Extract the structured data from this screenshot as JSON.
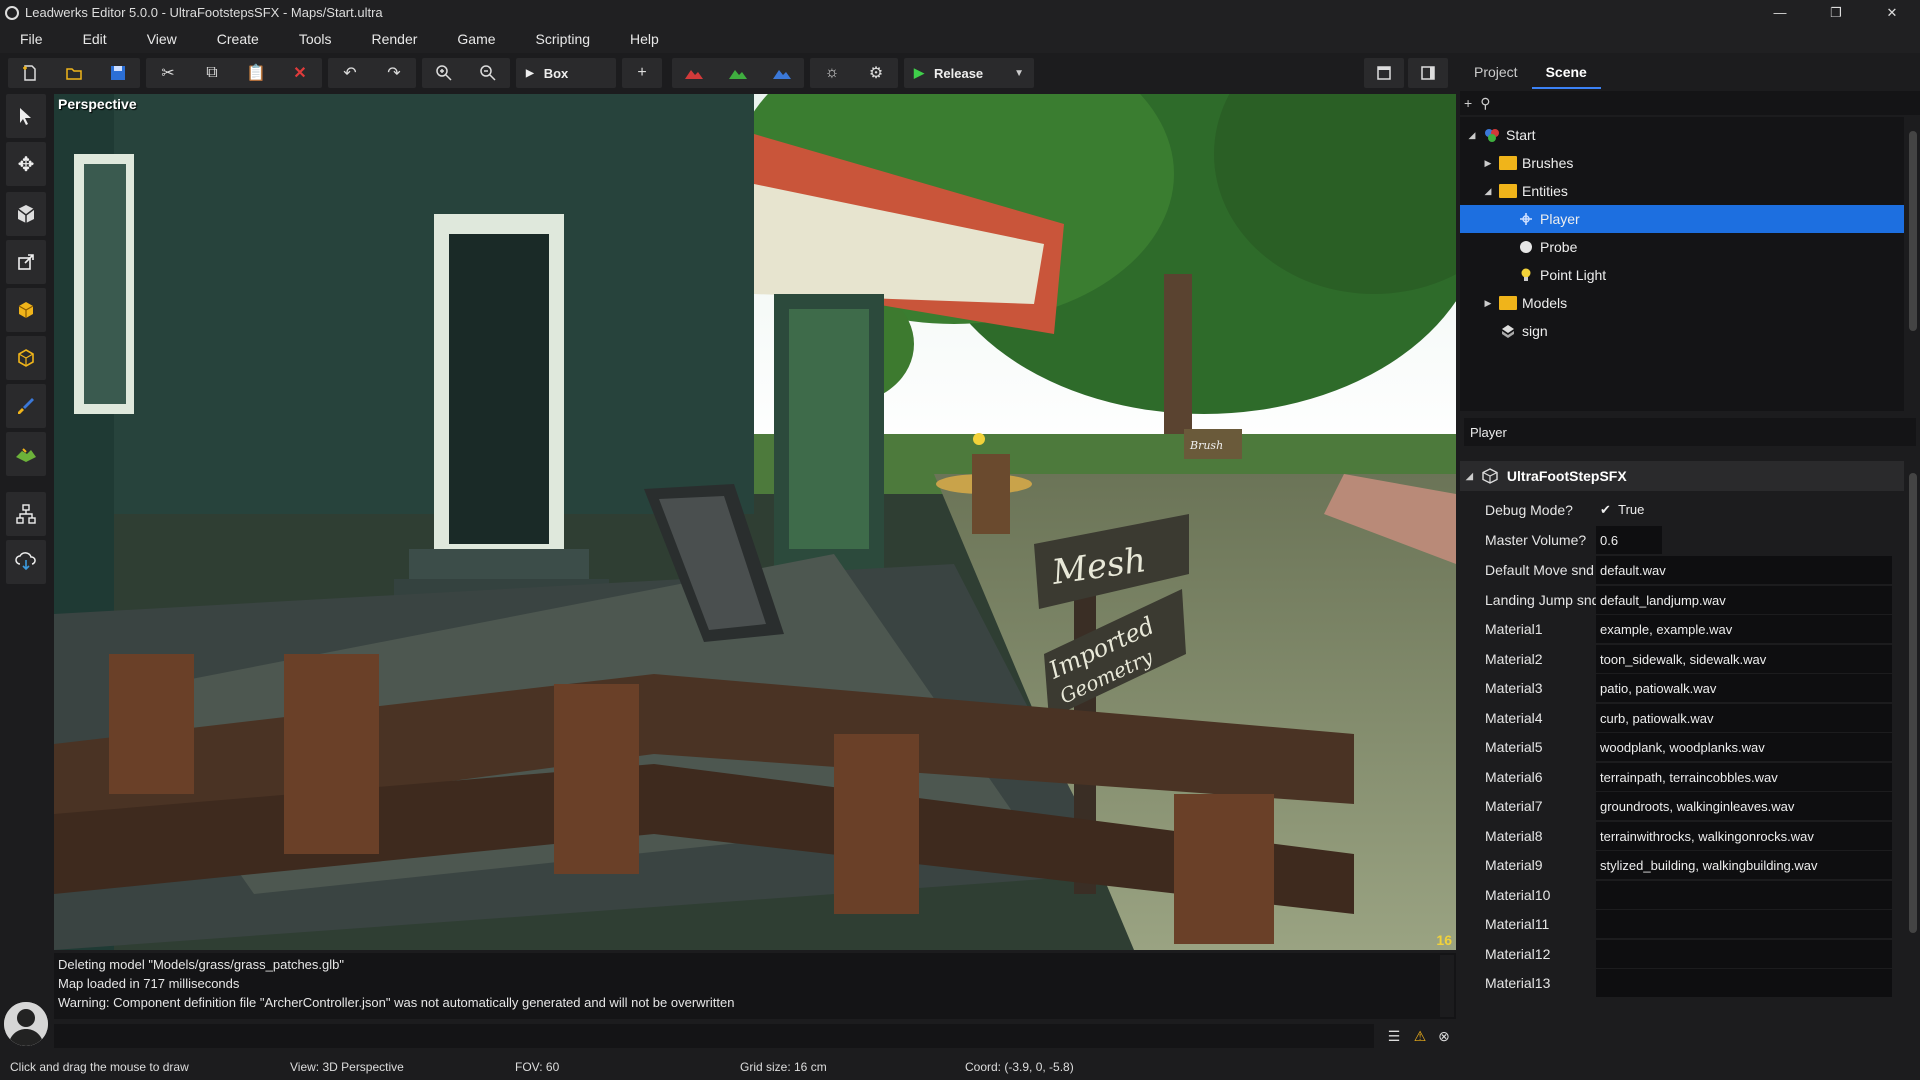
{
  "titlebar": {
    "title": "Leadwerks Editor 5.0.0 - UltraFootstepsSFX - Maps/Start.ultra",
    "minimize": "—",
    "maximize": "❐",
    "close": "✕"
  },
  "menu": [
    "File",
    "Edit",
    "View",
    "Create",
    "Tools",
    "Render",
    "Game",
    "Scripting",
    "Help"
  ],
  "toolbar": {
    "brush_shape": "Box",
    "build_config": "Release"
  },
  "viewport": {
    "label": "Perspective",
    "fps": "16",
    "signs": {
      "mesh": "Mesh",
      "imported": "Imported",
      "geometry": "Geometry",
      "brush": "Brush"
    }
  },
  "console": {
    "lines": [
      "Deleting model \"Models/grass/grass_patches.glb\"",
      "Map loaded in 717 milliseconds",
      "Warning: Component definition file \"ArcherController.json\" was not automatically generated and will not be overwritten"
    ]
  },
  "status": {
    "hint": "Click and drag the mouse to draw",
    "view": "View: 3D Perspective",
    "fov": "FOV: 60",
    "grid": "Grid size: 16 cm",
    "coord": "Coord: (-3.9, 0, -5.8)"
  },
  "panel": {
    "tabs": [
      "Project",
      "Scene"
    ],
    "active_tab": "Scene",
    "tree": [
      {
        "label": "Start",
        "depth": 0,
        "arrow": "◢",
        "icon": "scene-icon"
      },
      {
        "label": "Brushes",
        "depth": 1,
        "arrow": "▶",
        "icon": "folder-icon"
      },
      {
        "label": "Entities",
        "depth": 1,
        "arrow": "◢",
        "icon": "folder-icon"
      },
      {
        "label": "Player",
        "depth": 2,
        "arrow": "",
        "icon": "player-icon",
        "selected": true
      },
      {
        "label": "Probe",
        "depth": 2,
        "arrow": "",
        "icon": "probe-icon"
      },
      {
        "label": "Point Light",
        "depth": 2,
        "arrow": "",
        "icon": "light-bulb-icon"
      },
      {
        "label": "Models",
        "depth": 1,
        "arrow": "▶",
        "icon": "folder-icon"
      },
      {
        "label": "sign",
        "depth": 1,
        "arrow": "",
        "icon": "model-icon"
      }
    ],
    "entity_name": "Player",
    "component": {
      "name": "UltraFootStepSFX",
      "debug_label": "Debug Mode?",
      "debug_value": "True",
      "volume_label": "Master Volume?",
      "volume_value": "0.6",
      "properties": [
        {
          "label": "Default Move snd",
          "value": "default.wav"
        },
        {
          "label": "Landing Jump snd",
          "value": "default_landjump.wav"
        },
        {
          "label": "Material1",
          "value": "example, example.wav"
        },
        {
          "label": "Material2",
          "value": "toon_sidewalk, sidewalk.wav"
        },
        {
          "label": "Material3",
          "value": "patio, patiowalk.wav"
        },
        {
          "label": "Material4",
          "value": "curb, patiowalk.wav"
        },
        {
          "label": "Material5",
          "value": "woodplank, woodplanks.wav"
        },
        {
          "label": "Material6",
          "value": "terrainpath, terraincobbles.wav"
        },
        {
          "label": "Material7",
          "value": "groundroots, walkinginleaves.wav"
        },
        {
          "label": "Material8",
          "value": "terrainwithrocks, walkingonrocks.wav"
        },
        {
          "label": "Material9",
          "value": "stylized_building, walkingbuilding.wav"
        },
        {
          "label": "Material10",
          "value": ""
        },
        {
          "label": "Material11",
          "value": ""
        },
        {
          "label": "Material12",
          "value": ""
        },
        {
          "label": "Material13",
          "value": ""
        }
      ]
    }
  },
  "colors": {
    "accent": "#1d6fe0",
    "folder": "#f0b41a",
    "fps": "#f2d23a"
  }
}
